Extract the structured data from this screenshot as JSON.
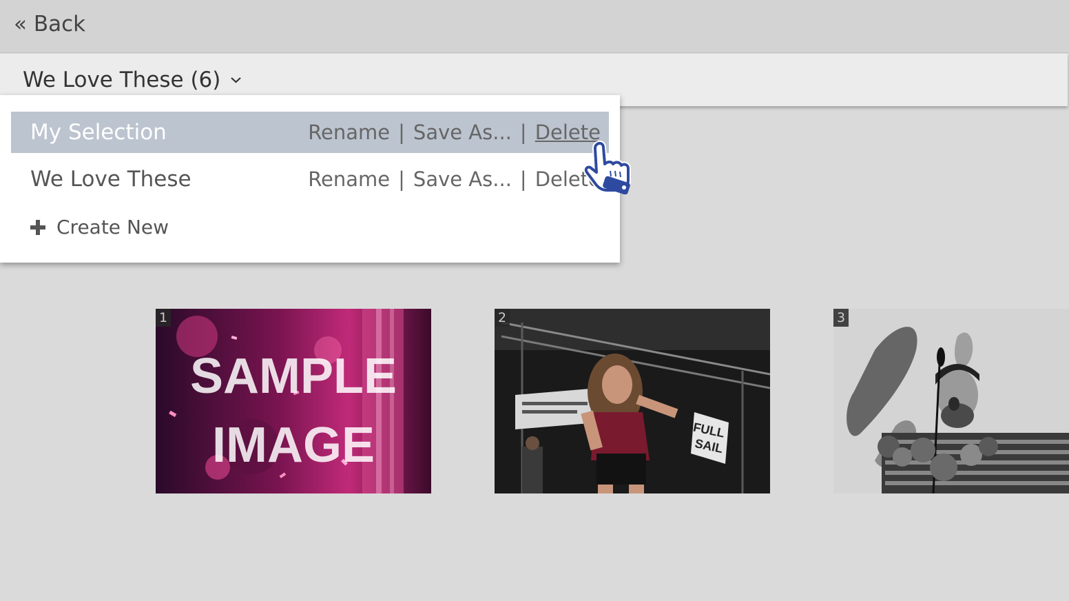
{
  "topbar": {
    "back_label": "« Back"
  },
  "selection_bar": {
    "title": "We Love These (6)"
  },
  "dropdown": {
    "rows": [
      {
        "name": "My Selection",
        "rename": "Rename",
        "save_as": "Save As...",
        "delete": "Delete",
        "sep": "|"
      },
      {
        "name": "We Love These",
        "rename": "Rename",
        "save_as": "Save As...",
        "delete": "Delete",
        "sep": "|"
      }
    ],
    "create_new": "Create New"
  },
  "thumbnails": [
    {
      "index": "1",
      "overlay_line1": "SAMPLE",
      "overlay_line2": "IMAGE"
    },
    {
      "index": "2",
      "sign_line1": "FULL",
      "sign_line2": "SAIL"
    },
    {
      "index": "3"
    }
  ],
  "colors": {
    "active_row": "#bcc4cf",
    "cursor": "#2e4aa0"
  },
  "icons": [
    "chevron-down-icon",
    "plus-icon",
    "hand-pointer-cursor-icon"
  ]
}
